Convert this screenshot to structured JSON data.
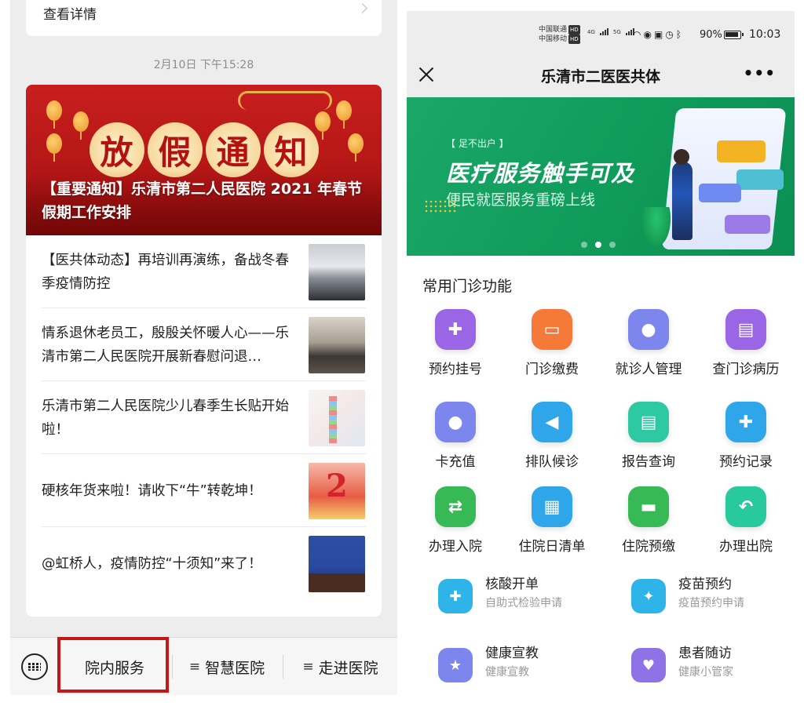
{
  "left": {
    "previous_card_label": "查看详情",
    "message_time": "2月10日 下午15:28",
    "cover": {
      "title_chars": [
        "放",
        "假",
        "通",
        "知"
      ],
      "caption": "【重要通知】乐清市第二人民医院 2021 年春节假期工作安排"
    },
    "news": [
      {
        "title": "【医共体动态】再培训再演练，备战冬春季疫情防控",
        "thumb": "meeting-photo"
      },
      {
        "title": "情系退休老员工，殷殷关怀暖人心——乐清市第二人民医院开展新春慰问退…",
        "thumb": "visit-photo"
      },
      {
        "title": "乐清市第二人民医院少儿春季生长贴开始啦！",
        "thumb": "child-height-photo"
      },
      {
        "title": "硬核年货来啦！请收下“牛”转乾坤！",
        "thumb": "new-year-ox-photo"
      },
      {
        "title": "@虹桥人，疫情防控“十须知”来了！",
        "thumb": "press-conference-photo"
      }
    ],
    "menu": {
      "keyboard_icon": "keyboard-icon",
      "items": [
        "院内服务",
        "智慧医院",
        "走进医院"
      ],
      "hamburger": "≡",
      "highlight_color": "#c41717"
    }
  },
  "right": {
    "status_bar": {
      "carrier1": "中国联通",
      "carrier2": "中国移动",
      "hd": "HD",
      "net1": "4G",
      "net2": "5G",
      "battery": "90%",
      "time": "10:03"
    },
    "nav": {
      "title": "乐清市二医医共体",
      "more": "•••"
    },
    "banner": {
      "tag": "【 足不出户 】",
      "headline": "医疗服务触手可及",
      "sub": "便民就医服务重磅上线",
      "active_dot": 1
    },
    "section_title": "常用门诊功能",
    "grid": [
      {
        "label": "预约挂号",
        "icon": "diamond-plus-icon",
        "glyph": "✚",
        "color": "#9a66e6"
      },
      {
        "label": "门诊缴费",
        "icon": "wallet-icon",
        "glyph": "▭",
        "color": "#f57a3a"
      },
      {
        "label": "就诊人管理",
        "icon": "user-gear-icon",
        "glyph": "●",
        "color": "#7c86ec"
      },
      {
        "label": "查门诊病历",
        "icon": "record-book-icon",
        "glyph": "▤",
        "color": "#9a66e6"
      },
      {
        "label": "卡充值",
        "icon": "user-card-icon",
        "glyph": "●",
        "color": "#7c86ec"
      },
      {
        "label": "排队候诊",
        "icon": "speaker-icon",
        "glyph": "◀",
        "color": "#2fa6ea"
      },
      {
        "label": "报告查询",
        "icon": "report-icon",
        "glyph": "▤",
        "color": "#2ec9a2"
      },
      {
        "label": "预约记录",
        "icon": "clipboard-icon",
        "glyph": "✚",
        "color": "#2fa6ea"
      },
      {
        "label": "办理入院",
        "icon": "transfer-icon",
        "glyph": "⇄",
        "color": "#37b955"
      },
      {
        "label": "住院日清单",
        "icon": "ledger-icon",
        "glyph": "▦",
        "color": "#2fa6ea"
      },
      {
        "label": "住院预缴",
        "icon": "card-icon",
        "glyph": "▬",
        "color": "#37b955"
      },
      {
        "label": "办理出院",
        "icon": "return-arrow-icon",
        "glyph": "↶",
        "color": "#27c99d"
      }
    ],
    "big_items": [
      {
        "title": "核酸开单",
        "desc": "自助式检验申请",
        "icon": "nurse-icon",
        "glyph": "✚",
        "color": "#2fb4ea"
      },
      {
        "title": "疫苗预约",
        "desc": "疫苗预约申请",
        "icon": "vaccine-icon",
        "glyph": "✦",
        "color": "#2fb4ea"
      },
      {
        "title": "健康宣教",
        "desc": "健康宣教",
        "icon": "star-book-icon",
        "glyph": "★",
        "color": "#7c86ec"
      },
      {
        "title": "患者随访",
        "desc": "健康小管家",
        "icon": "heart-icon",
        "glyph": "♥",
        "color": "#8e72e6"
      }
    ]
  }
}
